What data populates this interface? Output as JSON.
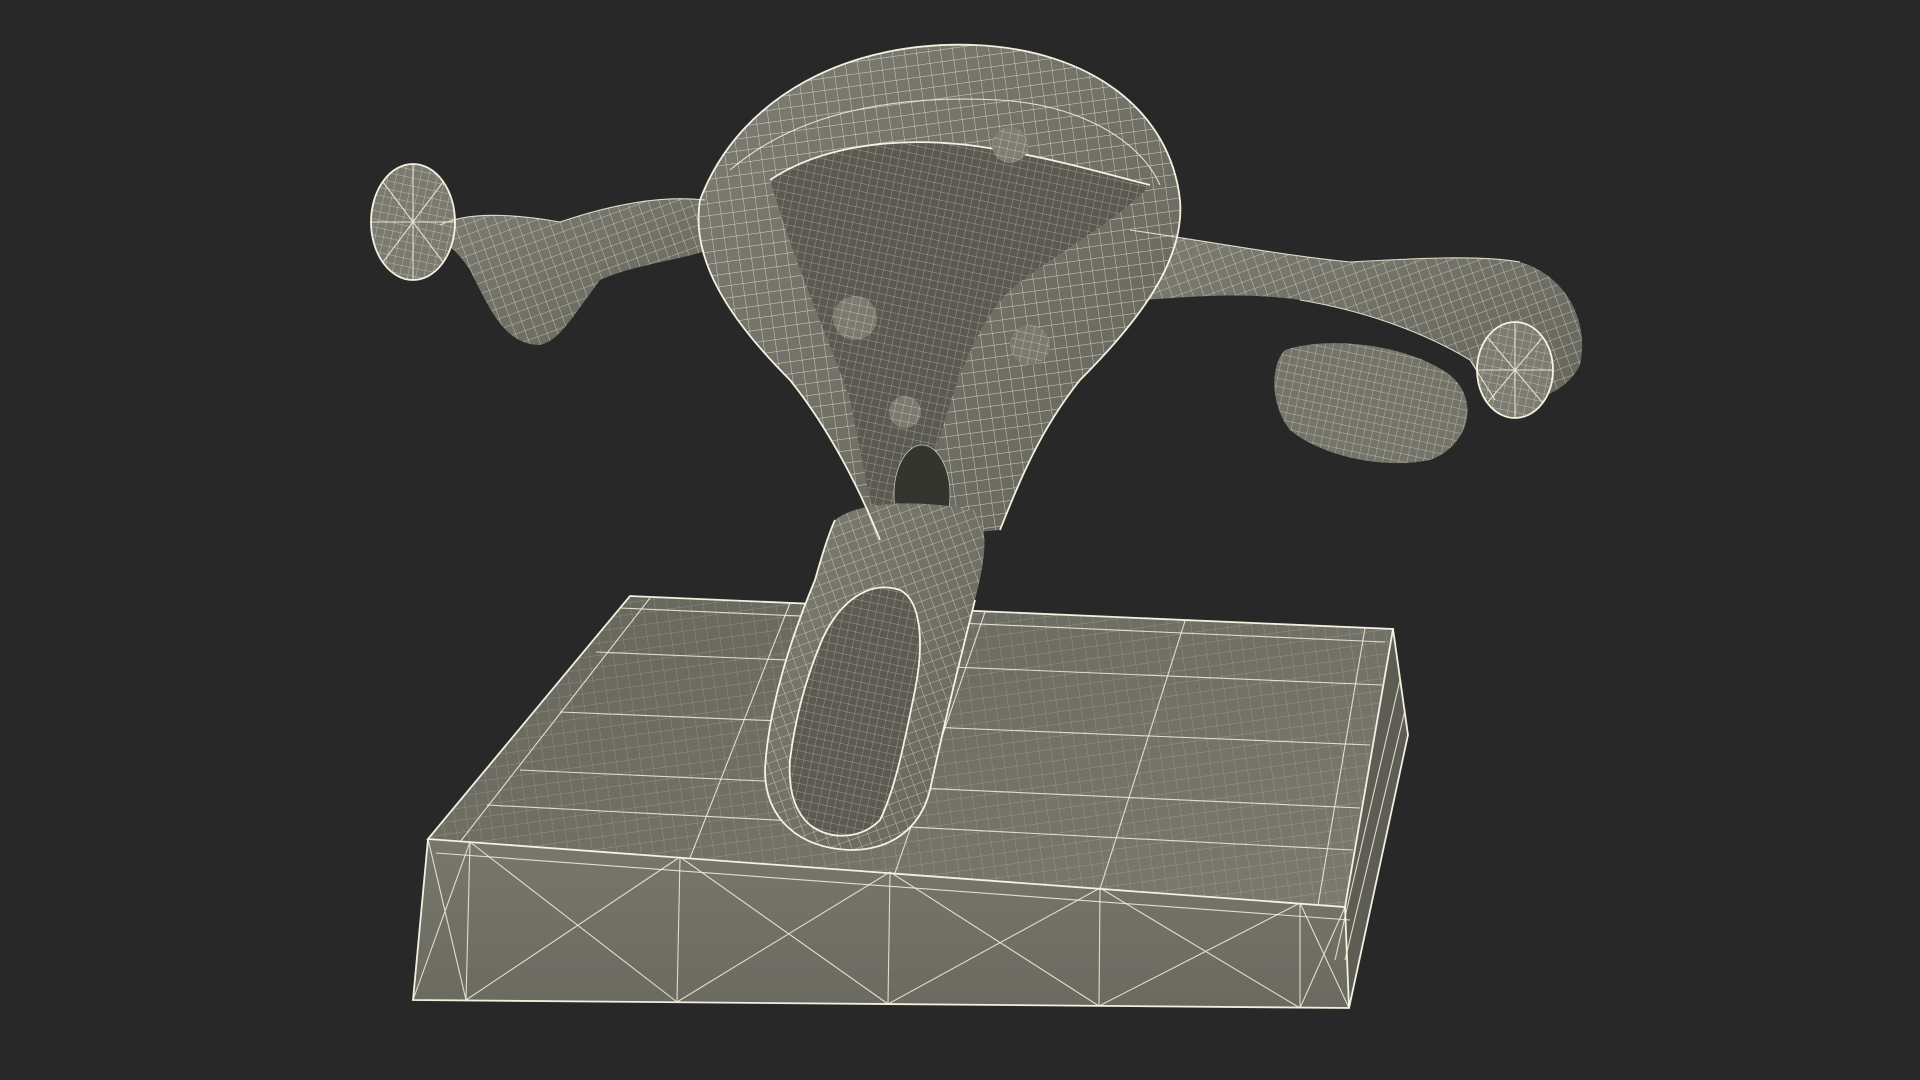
{
  "scene": {
    "background_color": "#282828",
    "mesh_fill_color": "#6f6f66",
    "mesh_shadow_color": "#56564f",
    "wire_color": "#f4f2dc",
    "model": "uterus-anatomy-model",
    "view_mode": "wireframe-on-shaded",
    "base": "rectangular-display-stand"
  }
}
